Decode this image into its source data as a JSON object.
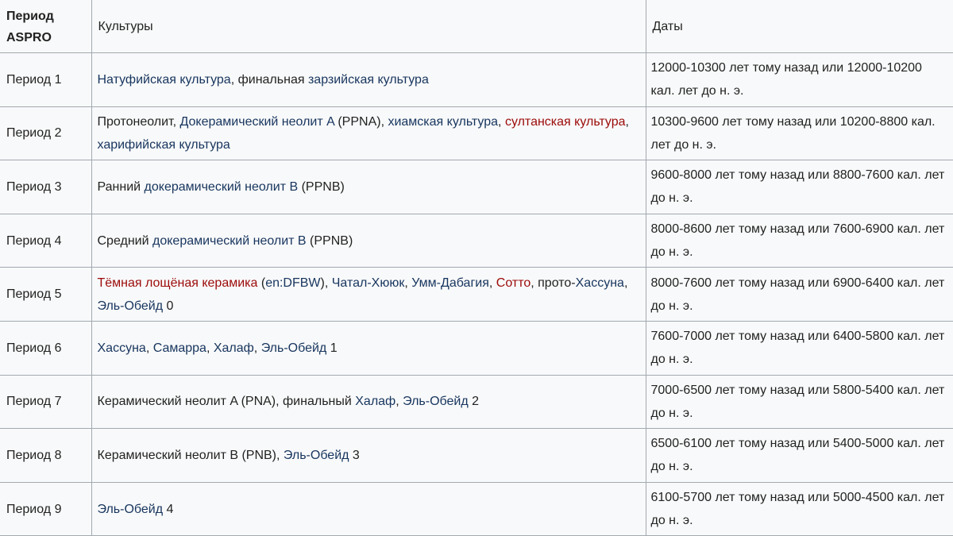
{
  "header": {
    "period": "Период ASPRO",
    "cultures": "Культуры",
    "dates": "Даты"
  },
  "link_colors": {
    "link": "#17355e",
    "red_link": "#9c0a0a"
  },
  "rows": [
    {
      "period": "Период 1",
      "cultures": [
        {
          "t": "Натуфийская культура",
          "k": "link"
        },
        {
          "t": ", финальная "
        },
        {
          "t": "зарзийская культура",
          "k": "link"
        }
      ],
      "dates": "12000-10300 лет тому назад или 12000-10200 кал. лет до н. э."
    },
    {
      "period": "Период 2",
      "cultures": [
        {
          "t": "Протонеолит, "
        },
        {
          "t": "Докерамический неолит A",
          "k": "link"
        },
        {
          "t": " (PPNA), "
        },
        {
          "t": "хиамская культура",
          "k": "link"
        },
        {
          "t": ", "
        },
        {
          "t": "султанская культура",
          "k": "redlink"
        },
        {
          "t": ", "
        },
        {
          "t": "харифийская культура",
          "k": "link"
        }
      ],
      "dates": "10300-9600 лет тому назад или 10200-8800 кал. лет до н. э."
    },
    {
      "period": "Период 3",
      "cultures": [
        {
          "t": "Ранний "
        },
        {
          "t": "докерамический неолит B",
          "k": "link"
        },
        {
          "t": " (PPNB)"
        }
      ],
      "dates": "9600-8000 лет тому назад или 8800-7600 кал. лет до н. э."
    },
    {
      "period": "Период 4",
      "cultures": [
        {
          "t": "Средний "
        },
        {
          "t": "докерамический неолит B",
          "k": "link"
        },
        {
          "t": " (PPNB)"
        }
      ],
      "dates": "8000-8600 лет тому назад или 7600-6900 кал. лет до н. э."
    },
    {
      "period": "Период 5",
      "cultures": [
        {
          "t": "Тёмная лощёная керамика",
          "k": "redlink"
        },
        {
          "t": " ("
        },
        {
          "t": "en:DFBW",
          "k": "link"
        },
        {
          "t": "), "
        },
        {
          "t": "Чатал-Хююк",
          "k": "link"
        },
        {
          "t": ", "
        },
        {
          "t": "Умм-Дабагия",
          "k": "link"
        },
        {
          "t": ", "
        },
        {
          "t": "Сотто",
          "k": "redlink"
        },
        {
          "t": ", прото-"
        },
        {
          "t": "Хассуна",
          "k": "link"
        },
        {
          "t": ", "
        },
        {
          "t": "Эль-Обейд",
          "k": "link"
        },
        {
          "t": " 0"
        }
      ],
      "dates": "8000-7600 лет тому назад или 6900-6400 кал. лет до н. э."
    },
    {
      "period": "Период 6",
      "cultures": [
        {
          "t": "Хассуна",
          "k": "link"
        },
        {
          "t": ", "
        },
        {
          "t": "Самарра",
          "k": "link"
        },
        {
          "t": ", "
        },
        {
          "t": "Халаф",
          "k": "link"
        },
        {
          "t": ", "
        },
        {
          "t": "Эль-Обейд",
          "k": "link"
        },
        {
          "t": " 1"
        }
      ],
      "dates": "7600-7000 лет тому назад или 6400-5800 кал. лет до н. э."
    },
    {
      "period": "Период 7",
      "cultures": [
        {
          "t": "Керамический неолит A (PNA), финальный "
        },
        {
          "t": "Халаф",
          "k": "link"
        },
        {
          "t": ", "
        },
        {
          "t": "Эль-Обейд",
          "k": "link"
        },
        {
          "t": " 2"
        }
      ],
      "dates": "7000-6500 лет тому назад или 5800-5400 кал. лет до н. э."
    },
    {
      "period": "Период 8",
      "cultures": [
        {
          "t": "Керамический неолит B (PNB), "
        },
        {
          "t": "Эль-Обейд",
          "k": "link"
        },
        {
          "t": " 3"
        }
      ],
      "dates": "6500-6100 лет тому назад или 5400-5000 кал. лет до н. э."
    },
    {
      "period": "Период 9",
      "cultures": [
        {
          "t": "Эль-Обейд",
          "k": "link"
        },
        {
          "t": " 4"
        }
      ],
      "dates": "6100-5700 лет тому назад или 5000-4500 кал. лет до н. э."
    }
  ]
}
